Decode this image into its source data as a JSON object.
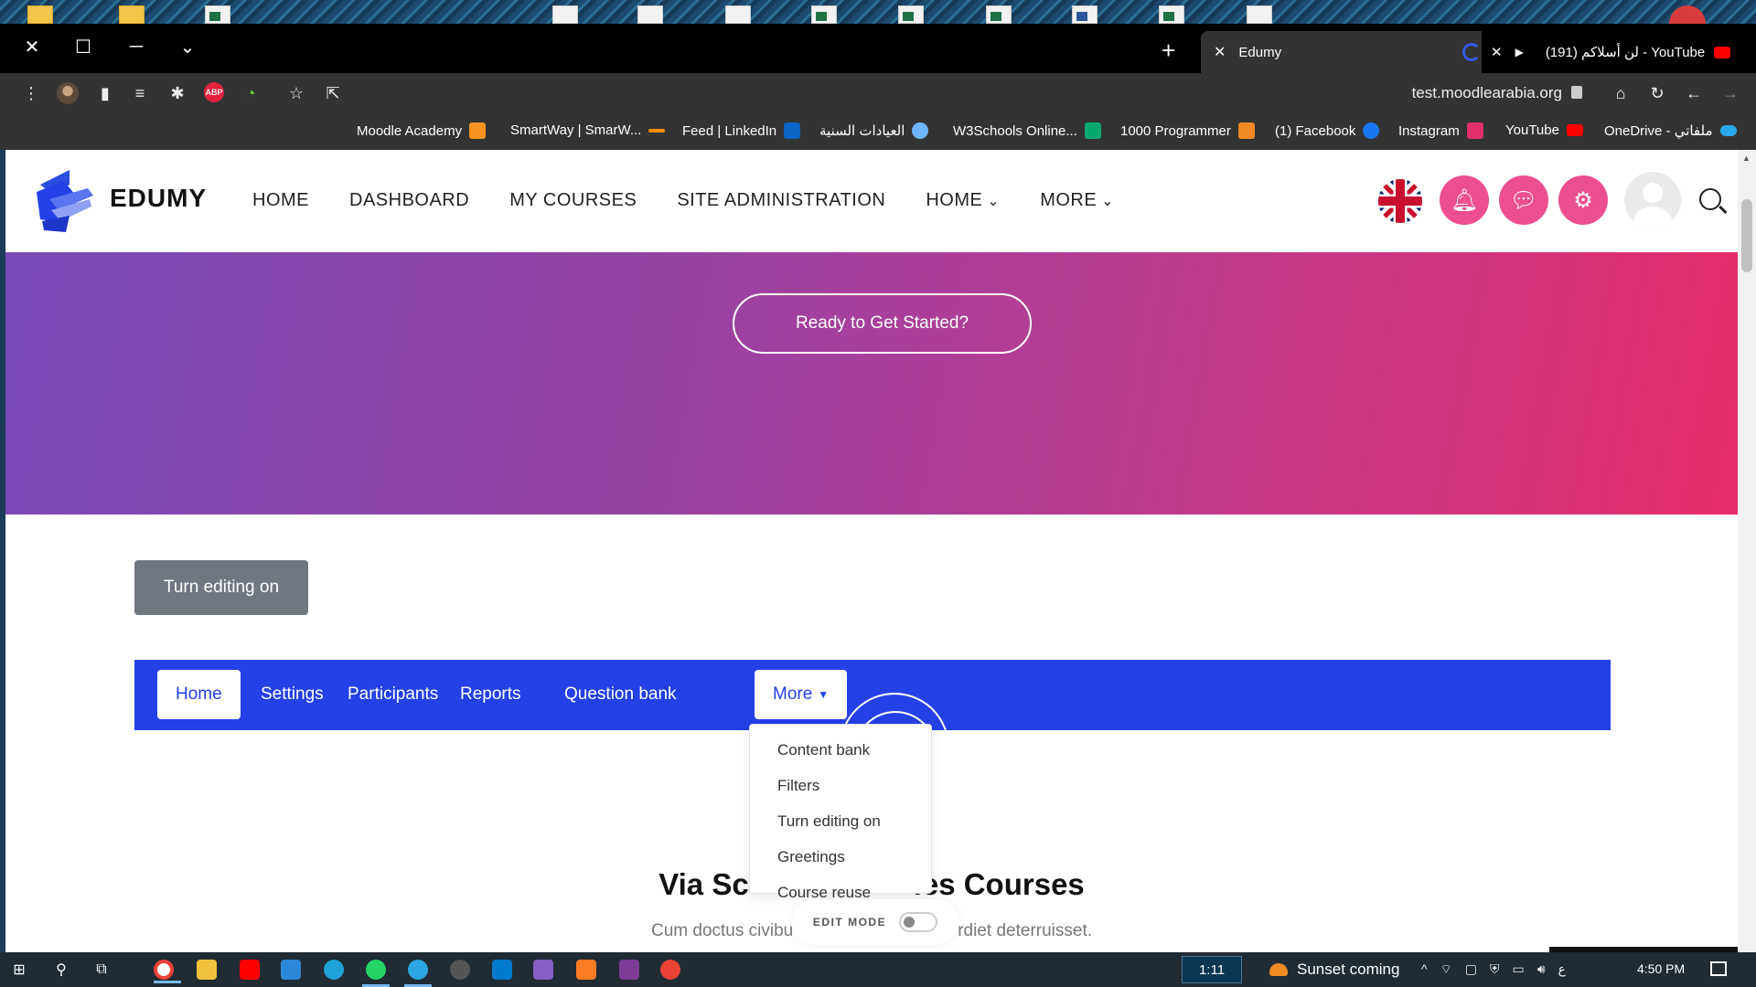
{
  "browser": {
    "active_tab": {
      "title": "Edumy"
    },
    "other_tab": {
      "title": "(191) لن أسلاكم - YouTube"
    },
    "url": "test.moodlearabia.org",
    "bookmarks": [
      {
        "label": "Moodle Academy",
        "color": "#f7931e"
      },
      {
        "label": "SmartWay | SmarW...",
        "color": "#ff8c00"
      },
      {
        "label": "Feed | LinkedIn",
        "color": "#0a66c2"
      },
      {
        "label": "العيادات السنية",
        "color": "#6fb4ff"
      },
      {
        "label": "W3Schools Online...",
        "color": "#04aa6d"
      },
      {
        "label": "1000 Programmer",
        "color": "#f08a24"
      },
      {
        "label": "(1) Facebook",
        "color": "#1877f2"
      },
      {
        "label": "Instagram",
        "color": "#e1306c"
      },
      {
        "label": "YouTube",
        "color": "#ff0000"
      },
      {
        "label": "OneDrive - ملفاتي",
        "color": "#28a8ea"
      }
    ]
  },
  "site": {
    "brand": "EDUMY",
    "nav": [
      "HOME",
      "DASHBOARD",
      "MY COURSES",
      "SITE ADMINISTRATION",
      "HOME",
      "MORE"
    ],
    "hero_cta": "Ready to Get Started?",
    "turn_editing_on": "Turn editing on",
    "secondary_nav": [
      "Home",
      "Settings",
      "Participants",
      "Reports",
      "Question bank",
      "More"
    ],
    "more_menu": [
      "Content bank",
      "Filters",
      "Turn editing on",
      "Greetings",
      "Course reuse"
    ],
    "section_title_left": "Via Sc",
    "section_title_right": "ies Courses",
    "section_sub_left": "Cum doctus civibu",
    "section_sub_right": "rdiet deterruisset.",
    "edit_mode_label": "EDIT MODE",
    "accent": "#2440e6",
    "pink": "#ec4e8f"
  },
  "taskbar": {
    "badge": "1:11",
    "weather": "Sunset coming",
    "lang": "ع",
    "time": "4:50 PM"
  }
}
